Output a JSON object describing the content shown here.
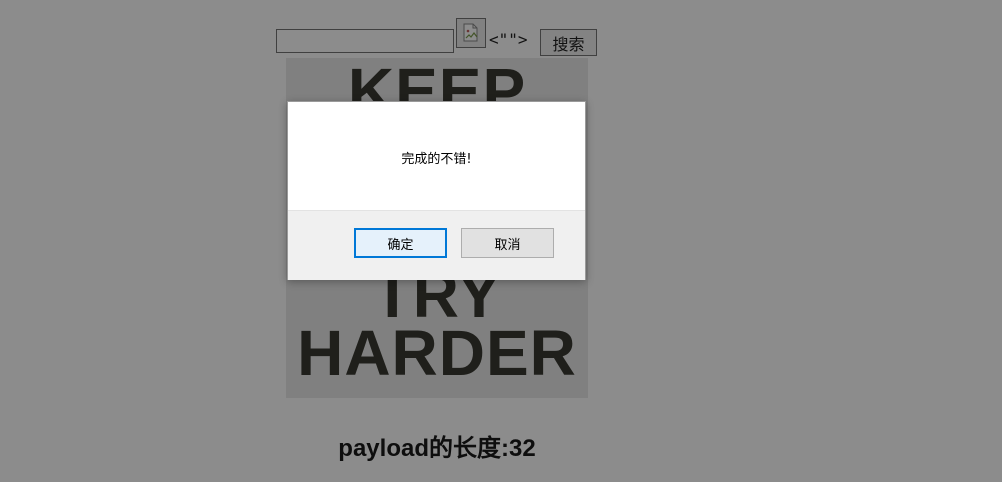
{
  "search": {
    "input_value": "",
    "quotes_text": "<\"\">",
    "button_label": "搜索"
  },
  "poster": {
    "line1": "KEEP",
    "line2": "TRY",
    "line3": "HARDER"
  },
  "payload_length_text": "payload的长度:32",
  "dialog": {
    "message": "完成的不错!",
    "ok_label": "确定",
    "cancel_label": "取消"
  },
  "icons": {
    "broken_image": "broken-image-icon"
  }
}
